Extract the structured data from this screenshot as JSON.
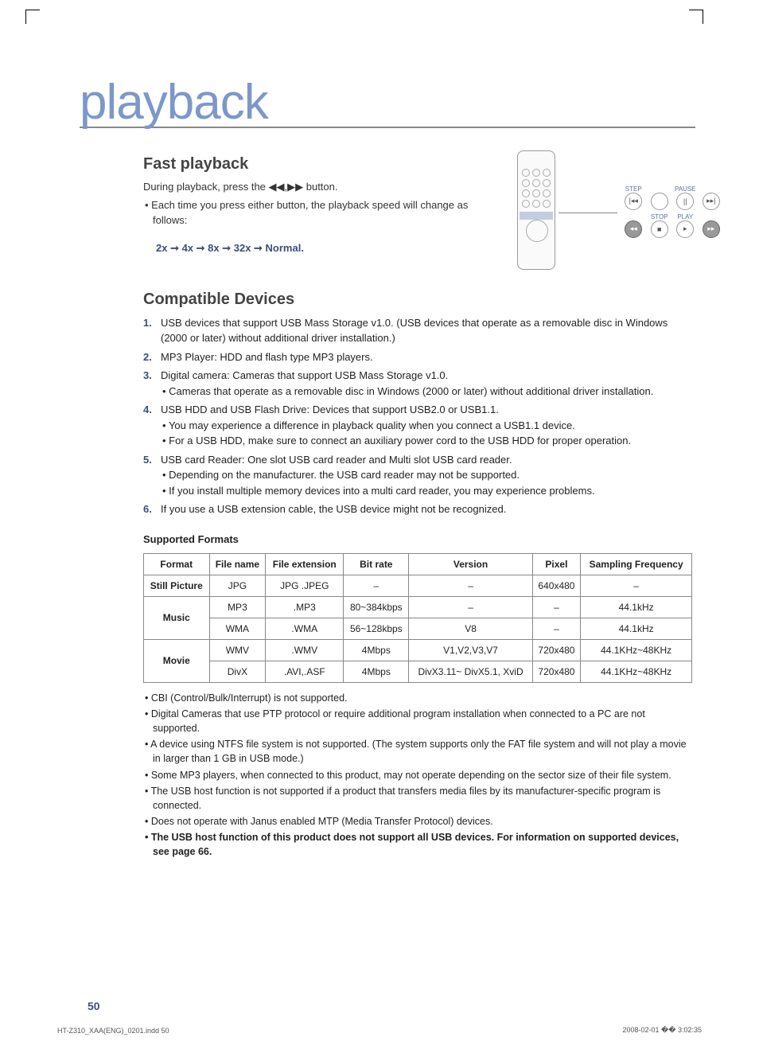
{
  "chapter_title": "playback",
  "section1": {
    "title": "Fast playback",
    "intro": "During playback, press the ◀◀,▶▶ button.",
    "bullet": "Each time you press either button, the playback speed will change as follows:",
    "sequence": "2x ➞ 4x ➞ 8x ➞ 32x ➞ Normal."
  },
  "remote_labels": {
    "step": "STEP",
    "pause": "PAUSE",
    "stop": "STOP",
    "play": "PLAY"
  },
  "section2": {
    "title": "Compatible Devices",
    "items": [
      {
        "n": "1.",
        "text": "USB devices that support USB Mass Storage v1.0. (USB devices that operate as a removable disc in Windows (2000 or later) without additional driver installation.)"
      },
      {
        "n": "2.",
        "text": "MP3 Player: HDD and flash type MP3 players."
      },
      {
        "n": "3.",
        "text": "Digital camera: Cameras that support USB Mass Storage v1.0.",
        "sub": [
          "Cameras that operate as a removable disc in Windows (2000 or later) without additional driver installation."
        ]
      },
      {
        "n": "4.",
        "text": "USB HDD and USB Flash Drive: Devices that support USB2.0 or USB1.1.",
        "sub": [
          "You may experience a difference in playback quality when you connect a USB1.1 device.",
          "For a USB HDD, make sure to connect an auxiliary power cord to the USB HDD for proper operation."
        ]
      },
      {
        "n": "5.",
        "text": "USB card Reader: One slot USB card reader and Multi slot USB card reader.",
        "sub": [
          "Depending on the manufacturer. the USB card reader may not be supported.",
          "If you install multiple memory devices into a multi card reader, you may experience problems."
        ]
      },
      {
        "n": "6.",
        "text": "If you use a USB extension cable, the USB device might not be recognized."
      }
    ]
  },
  "formats": {
    "title": "Supported Formats",
    "headers": [
      "Format",
      "File name",
      "File extension",
      "Bit rate",
      "Version",
      "Pixel",
      "Sampling Frequency"
    ],
    "rows": [
      {
        "cat": "Still Picture",
        "name": "JPG",
        "ext": "JPG .JPEG",
        "bit": "–",
        "ver": "–",
        "pix": "640x480",
        "freq": "–"
      },
      {
        "cat": "Music",
        "name": "MP3",
        "ext": ".MP3",
        "bit": "80~384kbps",
        "ver": "–",
        "pix": "–",
        "freq": "44.1kHz"
      },
      {
        "cat": "Music",
        "name": "WMA",
        "ext": ".WMA",
        "bit": "56~128kbps",
        "ver": "V8",
        "pix": "–",
        "freq": "44.1kHz"
      },
      {
        "cat": "Movie",
        "name": "WMV",
        "ext": ".WMV",
        "bit": "4Mbps",
        "ver": "V1,V2,V3,V7",
        "pix": "720x480",
        "freq": "44.1KHz~48KHz"
      },
      {
        "cat": "Movie",
        "name": "DivX",
        "ext": ".AVI,.ASF",
        "bit": "4Mbps",
        "ver": "DivX3.11~ DivX5.1, XviD",
        "pix": "720x480",
        "freq": "44.1KHz~48KHz"
      }
    ]
  },
  "notes": [
    "CBI (Control/Bulk/Interrupt) is not supported.",
    "Digital Cameras that use PTP protocol or require additional program installation when connected to a PC are not supported.",
    "A device using NTFS file system is not supported. (The system supports only the FAT file system and will not play a movie in larger than 1 GB in USB mode.)",
    "Some MP3 players, when connected to this product, may not operate depending on the sector size of their file system.",
    "The USB host function is not supported if a product that transfers media files by its manufacturer-specific program is connected.",
    "Does not operate with Janus enabled MTP (Media Transfer Protocol) devices."
  ],
  "notes_bold": "The USB host function of this product does not support all USB devices. For information on supported devices, see page 66.",
  "page_number": "50",
  "footer_left": "HT-Z310_XAA(ENG)_0201.indd   50",
  "footer_right": "2008-02-01   �� 3:02:35"
}
